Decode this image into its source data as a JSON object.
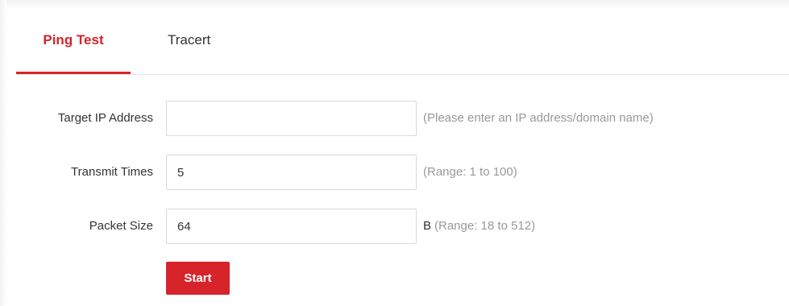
{
  "tabs": [
    {
      "label": "Ping Test",
      "active": true
    },
    {
      "label": "Tracert",
      "active": false
    }
  ],
  "form": {
    "target_ip": {
      "label": "Target IP Address",
      "value": "",
      "hint": "(Please enter an IP address/domain name)"
    },
    "transmit_times": {
      "label": "Transmit Times",
      "value": "5",
      "hint": "(Range: 1 to 100)"
    },
    "packet_size": {
      "label": "Packet Size",
      "value": "64",
      "unit": "B",
      "hint": "(Range: 18 to 512)"
    }
  },
  "actions": {
    "start_label": "Start"
  },
  "colors": {
    "accent": "#d7232a",
    "hint_text": "#999999",
    "border": "#d9d9d9"
  }
}
